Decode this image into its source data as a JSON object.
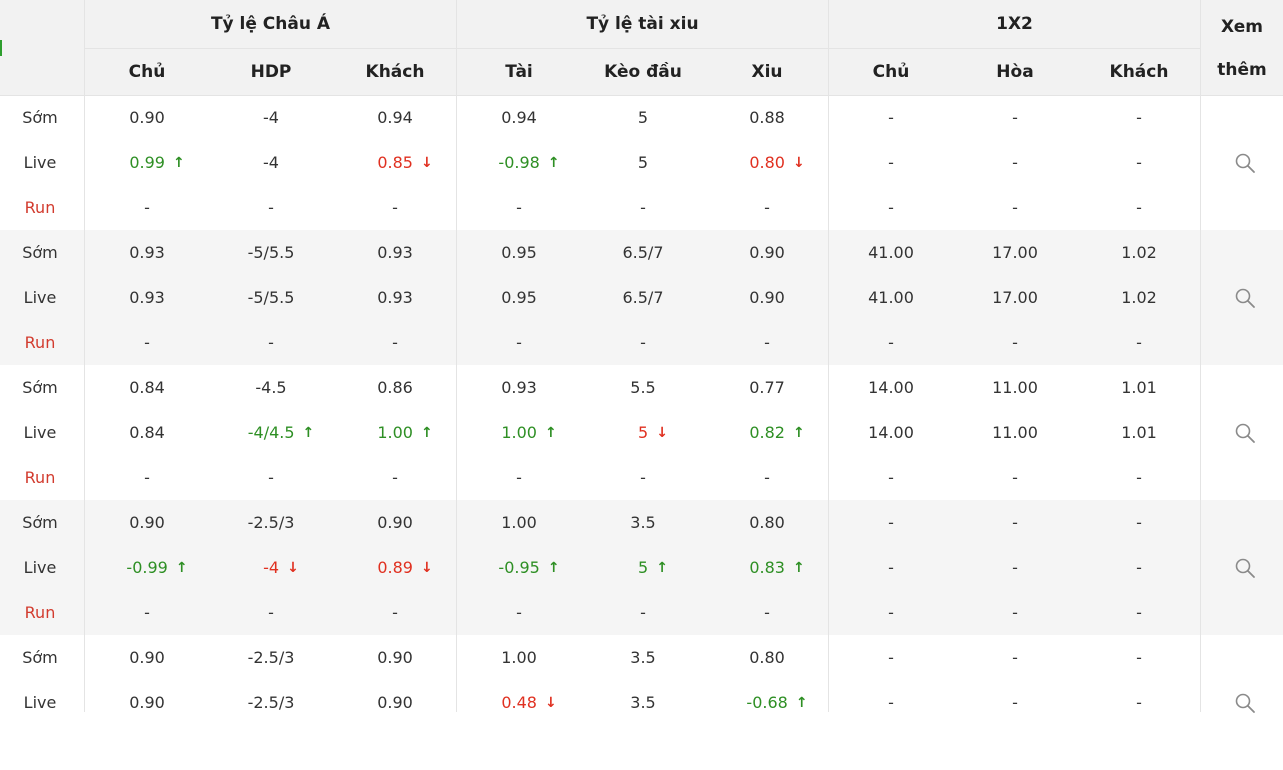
{
  "header": {
    "asian_group": "Tỷ lệ Châu Á",
    "ou_group": "Tỷ lệ tài xiu",
    "x12_group": "1X2",
    "more_line1": "Xem",
    "more_line2": "thêm",
    "cols": [
      "Chủ",
      "HDP",
      "Khách",
      "Tài",
      "Kèo đầu",
      "Xiu",
      "Chủ",
      "Hòa",
      "Khách"
    ]
  },
  "colors": {
    "up": "#2e8f24",
    "down": "#e03020",
    "run": "#d23b2e"
  },
  "blocks": [
    {
      "rows": [
        {
          "label": "Sớm",
          "cells": [
            {
              "v": "0.90"
            },
            {
              "v": "-4"
            },
            {
              "v": "0.94"
            },
            {
              "v": "0.94"
            },
            {
              "v": "5"
            },
            {
              "v": "0.88"
            },
            {
              "v": "-"
            },
            {
              "v": "-"
            },
            {
              "v": "-"
            }
          ]
        },
        {
          "label": "Live",
          "cells": [
            {
              "v": "0.99",
              "t": "up"
            },
            {
              "v": "-4"
            },
            {
              "v": "0.85",
              "t": "down"
            },
            {
              "v": "-0.98",
              "t": "up"
            },
            {
              "v": "5"
            },
            {
              "v": "0.80",
              "t": "down"
            },
            {
              "v": "-"
            },
            {
              "v": "-"
            },
            {
              "v": "-"
            }
          ]
        },
        {
          "label": "Run",
          "cells": [
            {
              "v": "-"
            },
            {
              "v": "-"
            },
            {
              "v": "-"
            },
            {
              "v": "-"
            },
            {
              "v": "-"
            },
            {
              "v": "-"
            },
            {
              "v": "-"
            },
            {
              "v": "-"
            },
            {
              "v": "-"
            }
          ]
        }
      ]
    },
    {
      "rows": [
        {
          "label": "Sớm",
          "cells": [
            {
              "v": "0.93"
            },
            {
              "v": "-5/5.5"
            },
            {
              "v": "0.93"
            },
            {
              "v": "0.95"
            },
            {
              "v": "6.5/7"
            },
            {
              "v": "0.90"
            },
            {
              "v": "41.00"
            },
            {
              "v": "17.00"
            },
            {
              "v": "1.02"
            }
          ]
        },
        {
          "label": "Live",
          "cells": [
            {
              "v": "0.93"
            },
            {
              "v": "-5/5.5"
            },
            {
              "v": "0.93"
            },
            {
              "v": "0.95"
            },
            {
              "v": "6.5/7"
            },
            {
              "v": "0.90"
            },
            {
              "v": "41.00"
            },
            {
              "v": "17.00"
            },
            {
              "v": "1.02"
            }
          ]
        },
        {
          "label": "Run",
          "cells": [
            {
              "v": "-"
            },
            {
              "v": "-"
            },
            {
              "v": "-"
            },
            {
              "v": "-"
            },
            {
              "v": "-"
            },
            {
              "v": "-"
            },
            {
              "v": "-"
            },
            {
              "v": "-"
            },
            {
              "v": "-"
            }
          ]
        }
      ]
    },
    {
      "rows": [
        {
          "label": "Sớm",
          "cells": [
            {
              "v": "0.84"
            },
            {
              "v": "-4.5"
            },
            {
              "v": "0.86"
            },
            {
              "v": "0.93"
            },
            {
              "v": "5.5"
            },
            {
              "v": "0.77"
            },
            {
              "v": "14.00"
            },
            {
              "v": "11.00"
            },
            {
              "v": "1.01"
            }
          ]
        },
        {
          "label": "Live",
          "cells": [
            {
              "v": "0.84"
            },
            {
              "v": "-4/4.5",
              "t": "up"
            },
            {
              "v": "1.00",
              "t": "up"
            },
            {
              "v": "1.00",
              "t": "up"
            },
            {
              "v": "5",
              "t": "down"
            },
            {
              "v": "0.82",
              "t": "up"
            },
            {
              "v": "14.00"
            },
            {
              "v": "11.00"
            },
            {
              "v": "1.01"
            }
          ]
        },
        {
          "label": "Run",
          "cells": [
            {
              "v": "-"
            },
            {
              "v": "-"
            },
            {
              "v": "-"
            },
            {
              "v": "-"
            },
            {
              "v": "-"
            },
            {
              "v": "-"
            },
            {
              "v": "-"
            },
            {
              "v": "-"
            },
            {
              "v": "-"
            }
          ]
        }
      ]
    },
    {
      "rows": [
        {
          "label": "Sớm",
          "cells": [
            {
              "v": "0.90"
            },
            {
              "v": "-2.5/3"
            },
            {
              "v": "0.90"
            },
            {
              "v": "1.00"
            },
            {
              "v": "3.5"
            },
            {
              "v": "0.80"
            },
            {
              "v": "-"
            },
            {
              "v": "-"
            },
            {
              "v": "-"
            }
          ]
        },
        {
          "label": "Live",
          "cells": [
            {
              "v": "-0.99",
              "t": "up"
            },
            {
              "v": "-4",
              "t": "down"
            },
            {
              "v": "0.89",
              "t": "down"
            },
            {
              "v": "-0.95",
              "t": "up"
            },
            {
              "v": "5",
              "t": "up"
            },
            {
              "v": "0.83",
              "t": "up"
            },
            {
              "v": "-"
            },
            {
              "v": "-"
            },
            {
              "v": "-"
            }
          ]
        },
        {
          "label": "Run",
          "cells": [
            {
              "v": "-"
            },
            {
              "v": "-"
            },
            {
              "v": "-"
            },
            {
              "v": "-"
            },
            {
              "v": "-"
            },
            {
              "v": "-"
            },
            {
              "v": "-"
            },
            {
              "v": "-"
            },
            {
              "v": "-"
            }
          ]
        }
      ]
    },
    {
      "rows": [
        {
          "label": "Sớm",
          "cells": [
            {
              "v": "0.90"
            },
            {
              "v": "-2.5/3"
            },
            {
              "v": "0.90"
            },
            {
              "v": "1.00"
            },
            {
              "v": "3.5"
            },
            {
              "v": "0.80"
            },
            {
              "v": "-"
            },
            {
              "v": "-"
            },
            {
              "v": "-"
            }
          ]
        },
        {
          "label": "Live",
          "cells": [
            {
              "v": "0.90"
            },
            {
              "v": "-2.5/3"
            },
            {
              "v": "0.90"
            },
            {
              "v": "0.48",
              "t": "down"
            },
            {
              "v": "3.5"
            },
            {
              "v": "-0.68",
              "t": "up"
            },
            {
              "v": "-"
            },
            {
              "v": "-"
            },
            {
              "v": "-"
            }
          ]
        }
      ]
    }
  ]
}
